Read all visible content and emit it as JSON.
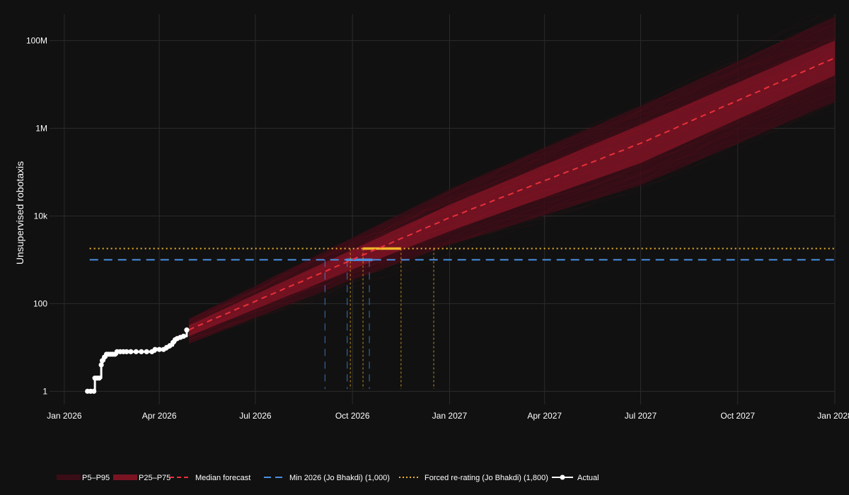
{
  "chart_data": {
    "type": "line",
    "ylabel": "Unsupervised robotaxis",
    "yscale": "log",
    "ylim": [
      0.5,
      400000000
    ],
    "xlim": [
      "2025-12-18",
      "2028-01-01"
    ],
    "x_ticks": [
      {
        "date": "2026-01-01",
        "label": "Jan 2026"
      },
      {
        "date": "2026-04-01",
        "label": "Apr 2026"
      },
      {
        "date": "2026-07-01",
        "label": "Jul 2026"
      },
      {
        "date": "2026-10-01",
        "label": "Oct 2026"
      },
      {
        "date": "2027-01-01",
        "label": "Jan 2027"
      },
      {
        "date": "2027-04-01",
        "label": "Apr 2027"
      },
      {
        "date": "2027-07-01",
        "label": "Jul 2027"
      },
      {
        "date": "2027-10-01",
        "label": "Oct 2027"
      },
      {
        "date": "2028-01-01",
        "label": "Jan 2028"
      }
    ],
    "y_ticks": [
      {
        "value": 1,
        "label": "1"
      },
      {
        "value": 100,
        "label": "100"
      },
      {
        "value": 10000,
        "label": "10k"
      },
      {
        "value": 1000000,
        "label": "1M"
      },
      {
        "value": 100000000,
        "label": "100M"
      }
    ],
    "grid": true,
    "legend_position": "bottom",
    "series": [
      {
        "name": "Actual",
        "color": "#ffffff",
        "style": "line-markers",
        "points": [
          [
            "2026-01-23",
            1
          ],
          [
            "2026-01-26",
            1
          ],
          [
            "2026-01-29",
            1
          ],
          [
            "2026-01-30",
            2
          ],
          [
            "2026-02-01",
            2
          ],
          [
            "2026-02-03",
            2
          ],
          [
            "2026-02-05",
            4
          ],
          [
            "2026-02-06",
            5
          ],
          [
            "2026-02-08",
            6
          ],
          [
            "2026-02-10",
            7
          ],
          [
            "2026-02-12",
            7
          ],
          [
            "2026-02-14",
            7
          ],
          [
            "2026-02-16",
            7
          ],
          [
            "2026-02-18",
            7
          ],
          [
            "2026-02-20",
            8
          ],
          [
            "2026-02-23",
            8
          ],
          [
            "2026-02-26",
            8
          ],
          [
            "2026-03-01",
            8
          ],
          [
            "2026-03-05",
            8
          ],
          [
            "2026-03-10",
            8
          ],
          [
            "2026-03-15",
            8
          ],
          [
            "2026-03-20",
            8
          ],
          [
            "2026-03-25",
            8
          ],
          [
            "2026-03-28",
            9
          ],
          [
            "2026-04-01",
            9
          ],
          [
            "2026-04-05",
            9
          ],
          [
            "2026-04-08",
            10
          ],
          [
            "2026-04-11",
            11
          ],
          [
            "2026-04-14",
            13
          ],
          [
            "2026-04-16",
            15
          ],
          [
            "2026-04-18",
            16
          ],
          [
            "2026-04-21",
            17
          ],
          [
            "2026-04-24",
            18
          ],
          [
            "2026-04-27",
            25
          ]
        ]
      },
      {
        "name": "Median forecast",
        "color": "#e8303a",
        "style": "dashed",
        "points": [
          [
            "2026-04-29",
            25
          ],
          [
            "2026-10-01",
            1000
          ],
          [
            "2027-01-01",
            9000
          ],
          [
            "2027-07-01",
            450000
          ],
          [
            "2028-01-01",
            40000000
          ]
        ]
      },
      {
        "name": "P25–P75",
        "color": "#7a1423",
        "style": "band",
        "lower": [
          [
            "2026-04-29",
            18
          ],
          [
            "2026-10-01",
            600
          ],
          [
            "2027-01-01",
            4500
          ],
          [
            "2027-07-01",
            160000
          ],
          [
            "2028-01-01",
            16000000
          ]
        ],
        "upper": [
          [
            "2026-04-29",
            32
          ],
          [
            "2026-10-01",
            1700
          ],
          [
            "2027-01-01",
            18000
          ],
          [
            "2027-07-01",
            1200000
          ],
          [
            "2028-01-01",
            100000000
          ]
        ]
      },
      {
        "name": "P5–P95",
        "color": "#3a0d16",
        "style": "band",
        "lower": [
          [
            "2026-04-29",
            12
          ],
          [
            "2026-10-01",
            350
          ],
          [
            "2027-01-01",
            2200
          ],
          [
            "2027-07-01",
            50000
          ],
          [
            "2028-01-01",
            4000000
          ]
        ],
        "upper": [
          [
            "2026-04-29",
            45
          ],
          [
            "2026-10-01",
            3200
          ],
          [
            "2027-01-01",
            40000
          ],
          [
            "2027-07-01",
            3200000
          ],
          [
            "2028-01-01",
            350000000
          ]
        ]
      },
      {
        "name": "Min 2026 (Jo Bhakdi) (1,000)",
        "color": "#4a90e2",
        "style": "hline-dashed",
        "value": 1000,
        "from": "2026-01-25",
        "to": "2028-01-01",
        "highlight": [
          "2026-09-25",
          "2026-10-20"
        ],
        "crossings": [
          "2026-09-05",
          "2026-09-26",
          "2026-10-17"
        ]
      },
      {
        "name": "Forced re-rating (Jo Bhakdi) (1,800)",
        "color": "#f0b429",
        "style": "hline-dotted",
        "value": 1800,
        "from": "2026-01-25",
        "to": "2028-01-01",
        "highlight": [
          "2026-10-11",
          "2026-11-16"
        ],
        "crossings": [
          "2026-09-29",
          "2026-10-11",
          "2026-11-16",
          "2026-12-17"
        ]
      }
    ]
  }
}
